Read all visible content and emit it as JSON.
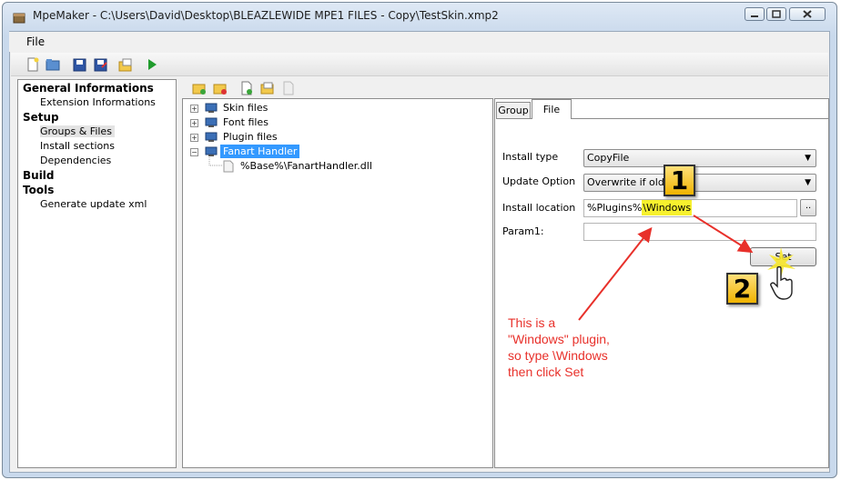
{
  "window": {
    "title": "MpeMaker - C:\\Users\\David\\Desktop\\BLEAZLEWIDE MPE1 FILES - Copy\\TestSkin.xmp2"
  },
  "menu": {
    "file": "File"
  },
  "nav": {
    "general": "General Informations",
    "extension_info": "Extension Informations",
    "setup": "Setup",
    "groups_files": "Groups & Files",
    "install_sections": "Install sections",
    "dependencies": "Dependencies",
    "build": "Build",
    "tools": "Tools",
    "generate_update": "Generate update xml"
  },
  "tree": {
    "skin_files": "Skin files",
    "font_files": "Font files",
    "plugin_files": "Plugin files",
    "fanart_handler": "Fanart Handler",
    "dll": "%Base%\\FanartHandler.dll"
  },
  "tabs": {
    "group": "Group",
    "file": "File"
  },
  "form": {
    "install_type_label": "Install type",
    "install_type_value": "CopyFile",
    "update_option_label": "Update Option",
    "update_option_value": "Overwrite if older",
    "install_location_label": "Install location",
    "install_location_prefix": "%Plugins%",
    "install_location_hl": "\\Windows",
    "param1_label": "Param1:",
    "browse": "..",
    "set": "Set"
  },
  "annotation": {
    "badge1": "1",
    "badge2": "2",
    "note": "This is a\n\"Windows\" plugin,\nso type \\Windows\nthen click Set"
  },
  "colors": {
    "accent_selected": "#3399ff",
    "annotation_red": "#e8302a",
    "highlight": "#f7f12e",
    "badge": "#f0b300"
  }
}
